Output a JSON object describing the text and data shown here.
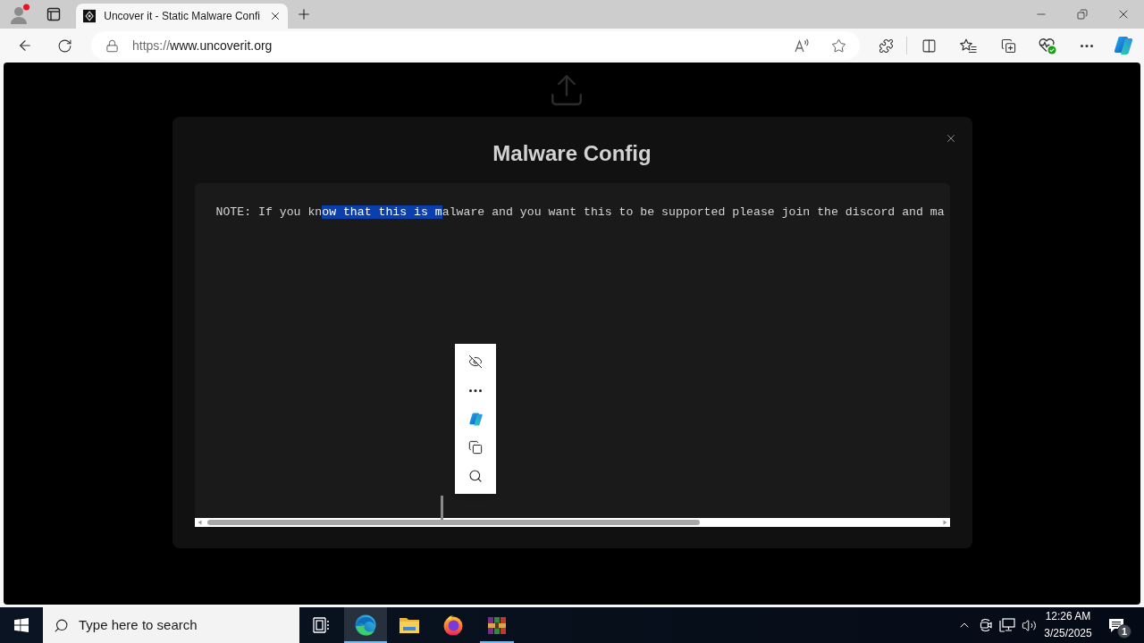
{
  "browser": {
    "tabs": [
      {
        "title": "Uncover it - Static Malware Confi",
        "selected": true
      }
    ],
    "url": {
      "scheme": "https://",
      "host": "www.uncoverit.org"
    }
  },
  "modal": {
    "title": "Malware Config",
    "note": [
      {
        "text": "NOTE: If you kn",
        "selected": false
      },
      {
        "text": "ow that this is m",
        "selected": true
      },
      {
        "text": "alware and you want this to be supported please join the discord and ma",
        "selected": false
      }
    ]
  },
  "taskbar": {
    "search_placeholder": "Type here to search",
    "apps": [
      {
        "kind": "edge",
        "selected": true,
        "running": true
      },
      {
        "kind": "folder",
        "selected": false,
        "running": false
      },
      {
        "kind": "firefox",
        "selected": false,
        "running": false
      },
      {
        "kind": "archive",
        "selected": false,
        "running": true
      }
    ],
    "clock": {
      "time": "12:26 AM",
      "date": "3/25/2025"
    },
    "notification_count": "1"
  }
}
